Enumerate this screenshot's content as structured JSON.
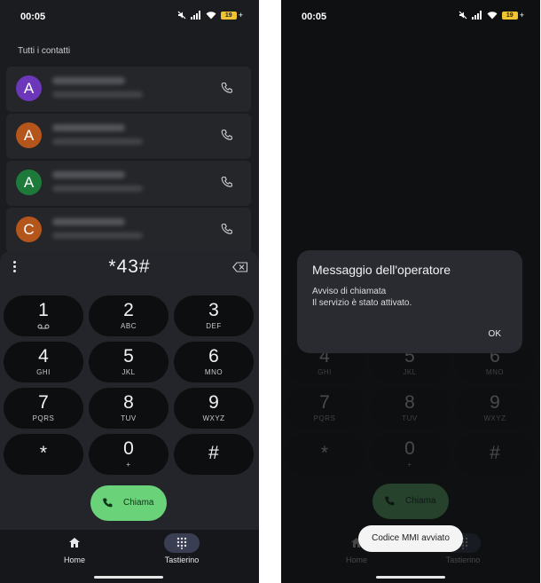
{
  "left": {
    "status": {
      "time": "00:05",
      "battery": "19"
    },
    "section_label": "Tutti i contatti",
    "contacts": [
      {
        "initial": "A",
        "color": "#6d37b9"
      },
      {
        "initial": "A",
        "color": "#b4561b"
      },
      {
        "initial": "A",
        "color": "#1d7a3a"
      },
      {
        "initial": "C",
        "color": "#b4561b"
      }
    ],
    "dialpad": {
      "number": "*43#",
      "keys": [
        {
          "digit": "1",
          "letters": ""
        },
        {
          "digit": "2",
          "letters": "ABC"
        },
        {
          "digit": "3",
          "letters": "DEF"
        },
        {
          "digit": "4",
          "letters": "GHI"
        },
        {
          "digit": "5",
          "letters": "JKL"
        },
        {
          "digit": "6",
          "letters": "MNO"
        },
        {
          "digit": "7",
          "letters": "PQRS"
        },
        {
          "digit": "8",
          "letters": "TUV"
        },
        {
          "digit": "9",
          "letters": "WXYZ"
        },
        {
          "digit": "*",
          "letters": ""
        },
        {
          "digit": "0",
          "letters": "+"
        },
        {
          "digit": "#",
          "letters": ""
        }
      ],
      "call_label": "Chiama"
    },
    "nav": {
      "home": "Home",
      "keypad": "Tastierino"
    }
  },
  "right": {
    "status": {
      "time": "00:05",
      "battery": "19"
    },
    "dialog": {
      "title": "Messaggio dell'operatore",
      "line1": "Avviso di chiamata",
      "line2": "Il servizio è stato attivato.",
      "ok": "OK"
    },
    "toast": "Codice MMI avviato",
    "call_label": "Chiama",
    "nav": {
      "home": "Home",
      "keypad": "Tastierino"
    },
    "keys": [
      {
        "digit": "4",
        "letters": "GHI"
      },
      {
        "digit": "5",
        "letters": "JKL"
      },
      {
        "digit": "6",
        "letters": "MNO"
      },
      {
        "digit": "7",
        "letters": "PQRS"
      },
      {
        "digit": "8",
        "letters": "TUV"
      },
      {
        "digit": "9",
        "letters": "WXYZ"
      },
      {
        "digit": "*",
        "letters": ""
      },
      {
        "digit": "0",
        "letters": "+"
      },
      {
        "digit": "#",
        "letters": ""
      }
    ]
  },
  "colors": {
    "accent_call": "#6ad37a",
    "keypad_pill": "#3a3e52"
  }
}
